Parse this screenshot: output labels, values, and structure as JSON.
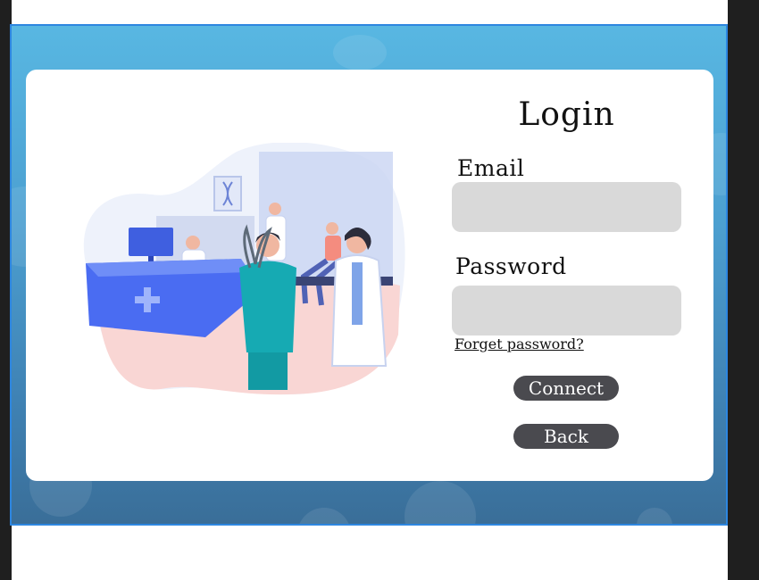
{
  "login": {
    "title": "Login",
    "email_label": "Email",
    "email_value": "",
    "password_label": "Password",
    "password_value": "",
    "forgot_password": "Forget password?",
    "connect_button": "Connect",
    "back_button": "Back"
  },
  "illustration": {
    "subject": "medical-clinic-reception-icon"
  },
  "colors": {
    "panel_gradient_top": "#58b7e2",
    "panel_gradient_bottom": "#3a6e98",
    "panel_border": "#2d86e0",
    "field_background": "#d9d9d9",
    "button_background": "#4a4a4f"
  }
}
